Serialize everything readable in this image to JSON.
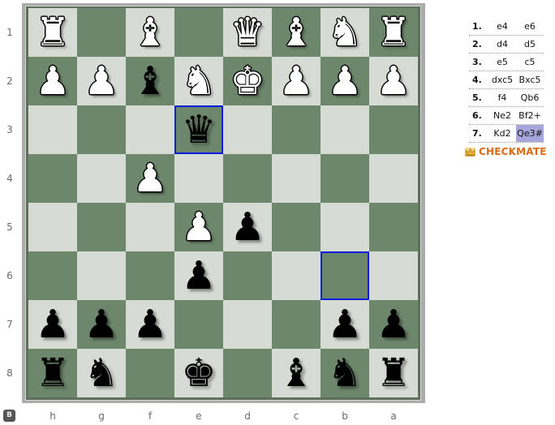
{
  "board": {
    "orientation": "black",
    "rank_labels": [
      "1",
      "2",
      "3",
      "4",
      "5",
      "6",
      "7",
      "8"
    ],
    "file_labels": [
      "h",
      "g",
      "f",
      "e",
      "d",
      "c",
      "b",
      "a"
    ],
    "colors": {
      "light": "#d6dcd4",
      "dark": "#6d876c",
      "highlight": "#0b1ee0"
    },
    "highlighted_squares": [
      "e3",
      "b6"
    ],
    "rows": [
      [
        "wR",
        "",
        "wB",
        "",
        "wQ",
        "wB",
        "wN",
        "wR"
      ],
      [
        "wP",
        "wP",
        "bB",
        "wN",
        "wK",
        "wP",
        "wP",
        "wP"
      ],
      [
        "",
        "",
        "",
        "bQ",
        "",
        "",
        "",
        ""
      ],
      [
        "",
        "",
        "wP",
        "",
        "",
        "",
        "",
        ""
      ],
      [
        "",
        "",
        "",
        "wP",
        "bP",
        "",
        "",
        ""
      ],
      [
        "",
        "",
        "",
        "bP",
        "",
        "",
        "",
        ""
      ],
      [
        "bP",
        "bP",
        "bP",
        "",
        "",
        "",
        "bP",
        "bP"
      ],
      [
        "bR",
        "bN",
        "",
        "bK",
        "",
        "bB",
        "bN",
        "bR"
      ]
    ]
  },
  "piece_glyphs": {
    "K": "♚",
    "Q": "♛",
    "R": "♜",
    "B": "♝",
    "N": "♞",
    "P": "♟"
  },
  "side_badge": "B",
  "moves": [
    {
      "num": "1.",
      "white": "e4",
      "black": "e6"
    },
    {
      "num": "2.",
      "white": "d4",
      "black": "d5"
    },
    {
      "num": "3.",
      "white": "e5",
      "black": "c5"
    },
    {
      "num": "4.",
      "white": "dxc5",
      "black": "Bxc5"
    },
    {
      "num": "5.",
      "white": "f4",
      "black": "Qb6"
    },
    {
      "num": "6.",
      "white": "Ne2",
      "black": "Bf2+"
    },
    {
      "num": "7.",
      "white": "Kd2",
      "black": "Qe3#"
    }
  ],
  "current_move_color": "#a6a6dc",
  "result": {
    "icon": "crown-icon",
    "text": "CHECKMATE",
    "color": "#e06a12"
  }
}
